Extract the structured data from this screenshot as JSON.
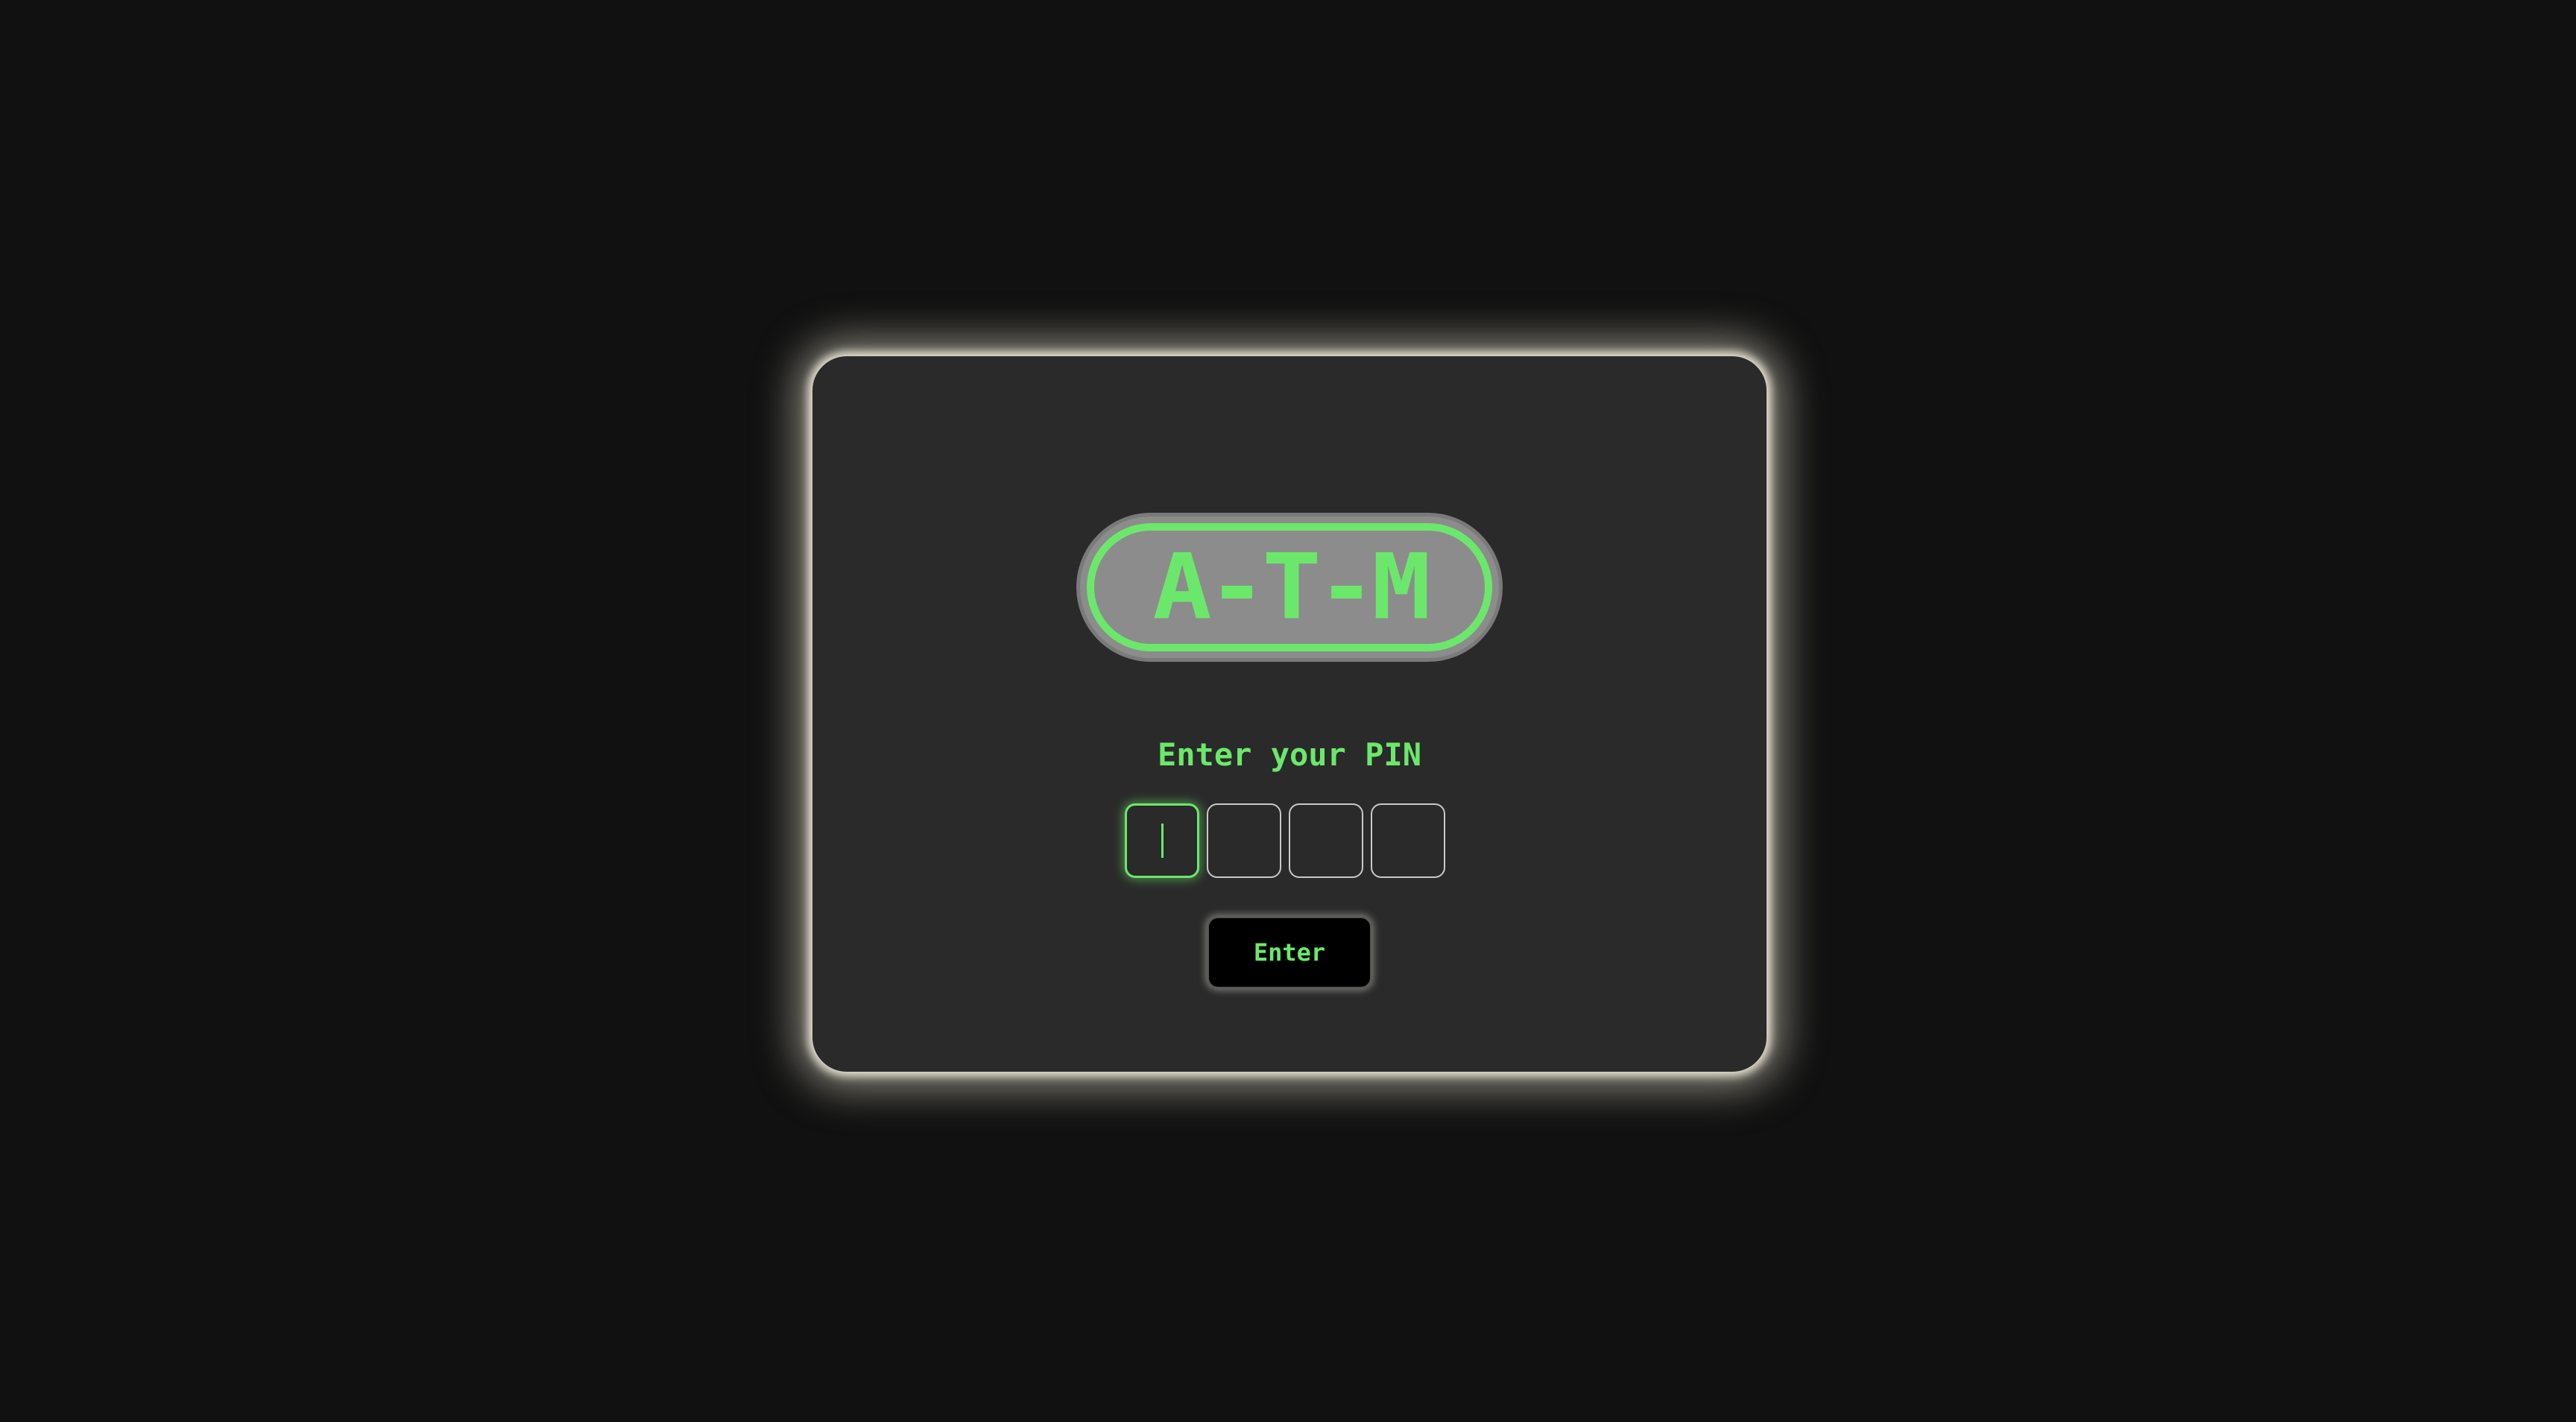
{
  "app": {
    "logo_text": "A-T-M"
  },
  "pin_entry": {
    "prompt": "Enter your PIN",
    "digits": [
      "",
      "",
      "",
      ""
    ],
    "active_index": 0
  },
  "actions": {
    "enter_label": "Enter"
  },
  "colors": {
    "background": "#111111",
    "card": "#2a2a2a",
    "accent_green": "#6be86b",
    "glow": "#e8e4d2",
    "logo_fill": "#8c8c8c"
  }
}
